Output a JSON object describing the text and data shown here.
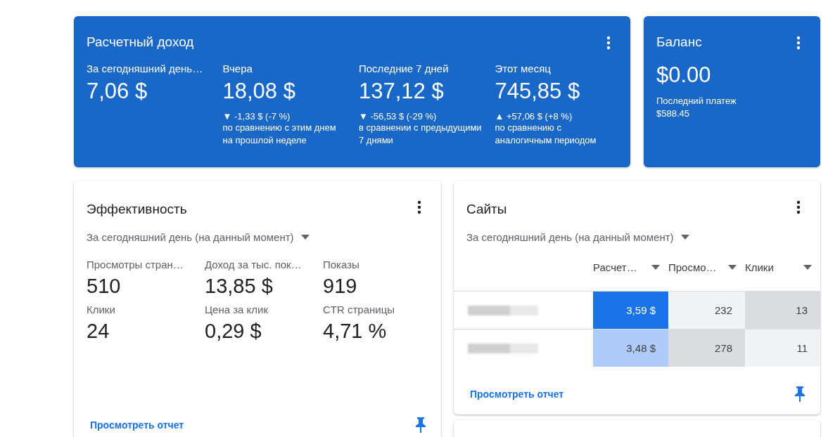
{
  "income": {
    "title": "Расчетный доход",
    "stats": [
      {
        "label": "За сегодняшний день…",
        "value": "7,06 $"
      },
      {
        "label": "Вчера",
        "value": "18,08 $",
        "delta": "▼ -1,33 $ (-7 %)",
        "comparison": "по сравнению с этим днем на прошлой неделе"
      },
      {
        "label": "Последние 7 дней",
        "value": "137,12 $",
        "delta": "▼ -56,53 $ (-29 %)",
        "comparison": "в сравнении с предыдущими 7 днями"
      },
      {
        "label": "Этот месяц",
        "value": "745,85 $",
        "delta": "▲ +57,06 $ (+8 %)",
        "comparison": "по сравнению с аналогичным периодом"
      }
    ]
  },
  "balance": {
    "title": "Баланс",
    "value": "$0.00",
    "last_payment_label": "Последний платеж",
    "last_payment": "$588.45"
  },
  "performance": {
    "title": "Эффективность",
    "period": "За сегодняшний день (на данный момент)",
    "metrics": [
      {
        "label": "Просмотры стран…",
        "value": "510"
      },
      {
        "label": "Доход за тыс. пок…",
        "value": "13,85 $"
      },
      {
        "label": "Показы",
        "value": "919"
      },
      {
        "label": "Клики",
        "value": "24"
      },
      {
        "label": "Цена за клик",
        "value": "0,29 $"
      },
      {
        "label": "CTR страницы",
        "value": "4,71 %"
      }
    ],
    "link": "Просмотреть отчет"
  },
  "sites": {
    "title": "Сайты",
    "period": "За сегодняшний день (на данный момент)",
    "columns": [
      {
        "label": "Расчет…"
      },
      {
        "label": "Просмо…"
      },
      {
        "label": "Клики"
      }
    ],
    "rows": [
      {
        "cells": [
          {
            "value": "3,59 $",
            "color": "#1a73e8"
          },
          {
            "value": "232",
            "color": "#f1f3f4"
          },
          {
            "value": "13",
            "color": "#dadce0"
          }
        ]
      },
      {
        "cells": [
          {
            "value": "3,48 $",
            "color": "#aecbfa"
          },
          {
            "value": "278",
            "color": "#dadce0"
          },
          {
            "value": "11",
            "color": "#f1f3f4"
          }
        ]
      }
    ],
    "link": "Просмотреть отчет"
  }
}
